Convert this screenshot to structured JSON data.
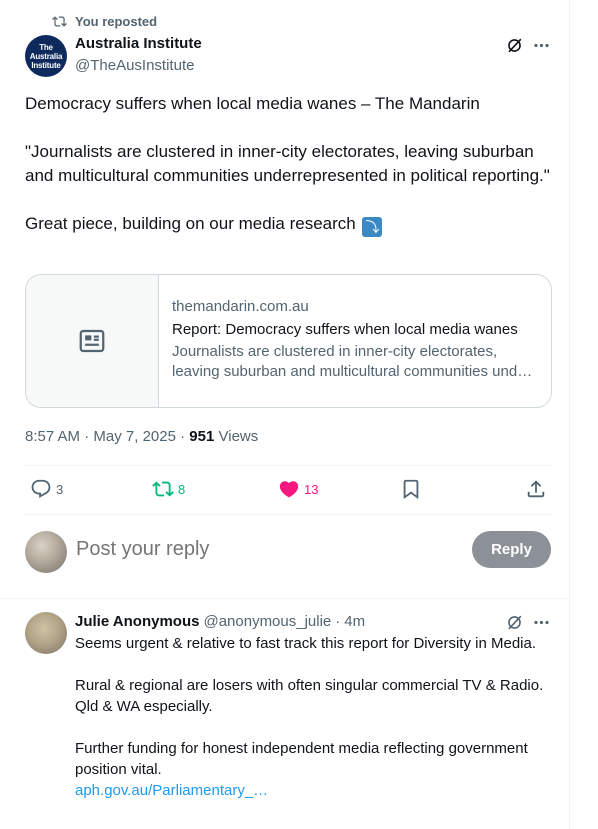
{
  "repost": {
    "label": "You reposted",
    "icon": "repost-icon"
  },
  "tweet": {
    "author_name": "Australia Institute",
    "author_handle": "@TheAusInstitute",
    "avatar_text": [
      "The",
      "Australia",
      "Institute"
    ],
    "text_line1": "Democracy suffers when local media wanes – The Mandarin",
    "text_quote": "\"Journalists are clustered in inner-city electorates, leaving suburban and multicultural communities underrepresented in political reporting.\"",
    "text_tail": "Great piece, building on our media research",
    "arrow_emoji": "⤵"
  },
  "card": {
    "domain": "themandarin.com.au",
    "title": "Report: Democracy suffers when local media wanes",
    "desc_line1": "Journalists are clustered in inner-city electorates,",
    "desc_line2": "leaving suburban and multicultural communities underrepresented"
  },
  "meta": {
    "time": "8:57 AM",
    "date": "May 7, 2025",
    "views_count": "951",
    "views_label": "Views"
  },
  "actions": {
    "replies": "3",
    "reposts": "8",
    "likes": "13"
  },
  "colors": {
    "repost_active": "#00ba7c",
    "like_active": "#f91880",
    "link": "#1d9bf0",
    "muted": "#536471"
  },
  "reply_box": {
    "placeholder": "Post your reply",
    "button": "Reply"
  },
  "comment": {
    "name": "Julie Anonymous",
    "handle": "@anonymous_julie",
    "time": "4m",
    "p1": "Seems urgent & relative to fast track this report  for Diversity in Media.",
    "p2": "Rural & regional are losers with often singular commercial TV & Radio. Qld & WA especially.",
    "p3": "Further funding for honest independent media reflecting government position vital.",
    "link": "aph.gov.au/Parliamentary_…"
  }
}
